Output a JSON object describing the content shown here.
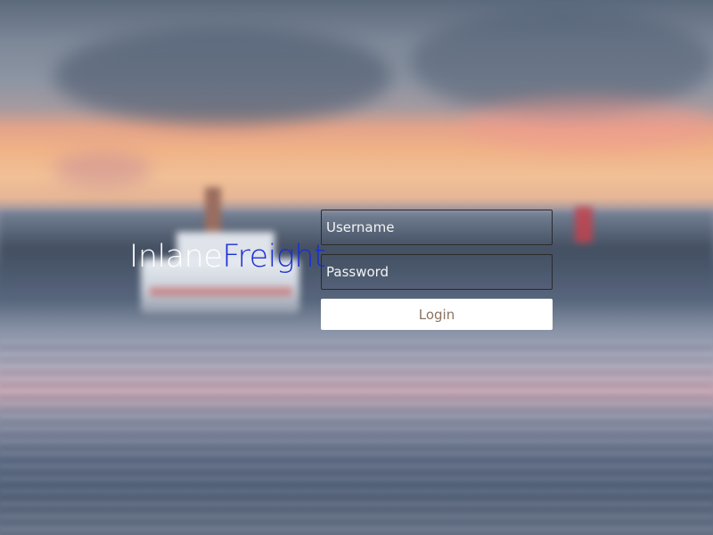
{
  "brand": {
    "name_part1": "Inlane",
    "name_part2": "Freight",
    "accent_color": "#1a2fd6"
  },
  "login_form": {
    "username_placeholder": "Username",
    "password_placeholder": "Password",
    "submit_label": "Login",
    "submit_text_color": "#8b7460"
  }
}
